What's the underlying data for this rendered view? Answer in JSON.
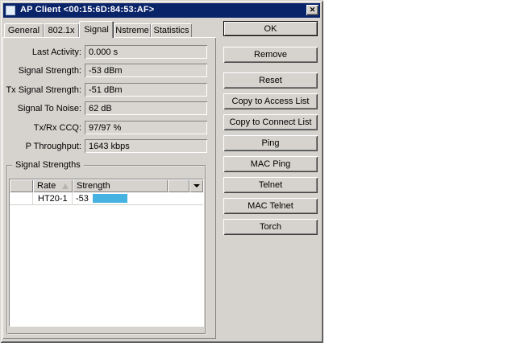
{
  "window": {
    "title": "AP Client <00:15:6D:84:53:AF>"
  },
  "tabs": [
    {
      "label": "General",
      "active": false
    },
    {
      "label": "802.1x",
      "active": false
    },
    {
      "label": "Signal",
      "active": true
    },
    {
      "label": "Nstreme",
      "active": false
    },
    {
      "label": "Statistics",
      "active": false
    }
  ],
  "fields": [
    {
      "label": "Last Activity:",
      "value": "0.000 s"
    },
    {
      "label": "Signal Strength:",
      "value": "-53 dBm"
    },
    {
      "label": "Tx Signal Strength:",
      "value": "-51 dBm"
    },
    {
      "label": "Signal To Noise:",
      "value": "62 dB"
    },
    {
      "label": "Tx/Rx CCQ:",
      "value": "97/97 %"
    },
    {
      "label": "P Throughput:",
      "value": "1643 kbps"
    }
  ],
  "signal_strengths": {
    "title": "Signal Strengths",
    "table": {
      "col_rate": "Rate",
      "col_strength": "Strength",
      "rows": [
        {
          "rate": "HT20-1",
          "strength": "-53"
        }
      ]
    }
  },
  "buttons": [
    {
      "label": "OK"
    },
    {
      "label": "Remove"
    },
    {
      "label": "Reset"
    },
    {
      "label": "Copy to Access List"
    },
    {
      "label": "Copy to Connect List"
    },
    {
      "label": "Ping"
    },
    {
      "label": "MAC Ping"
    },
    {
      "label": "Telnet"
    },
    {
      "label": "MAC Telnet"
    },
    {
      "label": "Torch"
    }
  ],
  "colors": {
    "titlebar_bg": "#0a246a",
    "title_text": "#ffffff",
    "dialog_bg": "#d6d3ce",
    "strength_bar": "#45b2e2",
    "page_bg": "#ffffff"
  }
}
